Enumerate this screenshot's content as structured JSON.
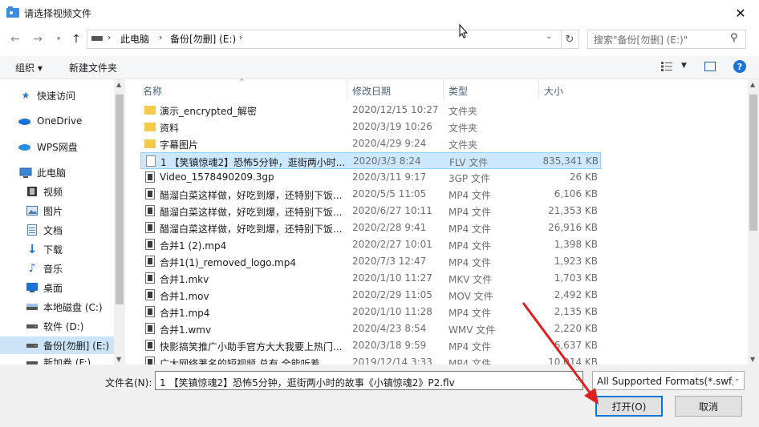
{
  "window": {
    "title": "请选择视频文件",
    "close_glyph": "✕"
  },
  "address": {
    "crumbs": [
      "此电脑",
      "备份[勿删] (E:)"
    ],
    "search_placeholder": "搜索\"备份[勿删] (E:)\""
  },
  "toolbar": {
    "organize_label": "组织 ▾",
    "new_folder_label": "新建文件夹"
  },
  "sidebar": {
    "items": [
      {
        "label": "快速访问",
        "icon": "star-icon"
      },
      {
        "label": "OneDrive",
        "icon": "cloud-icon"
      },
      {
        "label": "WPS网盘",
        "icon": "cloud-icon"
      },
      {
        "label": "此电脑",
        "icon": "computer-icon"
      },
      {
        "label": "视频",
        "icon": "video-folder-icon"
      },
      {
        "label": "图片",
        "icon": "pictures-folder-icon"
      },
      {
        "label": "文档",
        "icon": "documents-folder-icon"
      },
      {
        "label": "下载",
        "icon": "download-icon"
      },
      {
        "label": "音乐",
        "icon": "music-icon"
      },
      {
        "label": "桌面",
        "icon": "desktop-icon"
      },
      {
        "label": "本地磁盘 (C:)",
        "icon": "drive-icon"
      },
      {
        "label": "软件 (D:)",
        "icon": "drive-icon"
      },
      {
        "label": "备份[勿删] (E:)",
        "icon": "drive-icon"
      },
      {
        "label": "新加卷 (F:)",
        "icon": "drive-icon"
      }
    ],
    "selected_label": "备份[勿删] (E:)"
  },
  "columns": {
    "name": "名称",
    "date": "修改日期",
    "type": "类型",
    "size": "大小"
  },
  "files": [
    {
      "name": "演示_encrypted_解密",
      "date": "2020/12/15 10:27",
      "type": "文件夹",
      "size": "",
      "icon": "folder-icon"
    },
    {
      "name": "资料",
      "date": "2020/3/19 10:26",
      "type": "文件夹",
      "size": "",
      "icon": "folder-icon"
    },
    {
      "name": "字幕图片",
      "date": "2020/4/29 9:24",
      "type": "文件夹",
      "size": "",
      "icon": "folder-icon"
    },
    {
      "name": "1 【笑镇惊魂2】恐怖5分钟，逛街两小时...",
      "date": "2020/3/3 8:24",
      "type": "FLV 文件",
      "size": "835,341 KB",
      "icon": "file-icon",
      "selected": true
    },
    {
      "name": "Video_1578490209.3gp",
      "date": "2020/3/11 9:17",
      "type": "3GP 文件",
      "size": "26 KB",
      "icon": "video-file-icon"
    },
    {
      "name": "醋溜白菜这样做，好吃到爆，还特别下饭...",
      "date": "2020/5/5 11:05",
      "type": "MP4 文件",
      "size": "6,106 KB",
      "icon": "video-file-icon"
    },
    {
      "name": "醋溜白菜这样做，好吃到爆，还特别下饭...",
      "date": "2020/6/27 10:11",
      "type": "MP4 文件",
      "size": "21,353 KB",
      "icon": "video-file-icon"
    },
    {
      "name": "醋溜白菜这样做，好吃到爆，还特别下饭...",
      "date": "2020/2/28 9:41",
      "type": "MP4 文件",
      "size": "26,916 KB",
      "icon": "video-file-icon"
    },
    {
      "name": "合并1 (2).mp4",
      "date": "2020/2/27 10:01",
      "type": "MP4 文件",
      "size": "1,398 KB",
      "icon": "video-file-icon"
    },
    {
      "name": "合并1(1)_removed_logo.mp4",
      "date": "2020/7/3 12:47",
      "type": "MP4 文件",
      "size": "1,923 KB",
      "icon": "video-file-icon"
    },
    {
      "name": "合并1.mkv",
      "date": "2020/1/10 11:27",
      "type": "MKV 文件",
      "size": "1,703 KB",
      "icon": "video-file-icon"
    },
    {
      "name": "合并1.mov",
      "date": "2020/2/29 11:05",
      "type": "MOV 文件",
      "size": "2,492 KB",
      "icon": "video-file-icon"
    },
    {
      "name": "合并1.mp4",
      "date": "2020/1/10 11:28",
      "type": "MP4 文件",
      "size": "2,135 KB",
      "icon": "video-file-icon"
    },
    {
      "name": "合并1.wmv",
      "date": "2020/4/23 8:54",
      "type": "WMV 文件",
      "size": "2,220 KB",
      "icon": "video-file-icon"
    },
    {
      "name": "快影搞笑推广小助手官方大大我要上热门...",
      "date": "2020/3/18 9:59",
      "type": "MP4 文件",
      "size": "6,637 KB",
      "icon": "video-file-icon"
    },
    {
      "name": "广大网络著名的短视频 总有 全能听着...",
      "date": "2019/12/14 3:33",
      "type": "MP4 文件",
      "size": "10,014 KB",
      "icon": "video-file-icon"
    }
  ],
  "footer": {
    "filename_label": "文件名(N):",
    "filename_value": "1 【笑镇惊魂2】恐怖5分钟，逛街两小时的故事《小镇惊魂2》P2.flv",
    "filter_value": "All Supported Formats(*.swf;",
    "open_label": "打开(O)",
    "cancel_label": "取消"
  },
  "colors": {
    "accent": "#0078d7",
    "selection": "#cce8ff",
    "annotation_arrow": "#e02020"
  }
}
